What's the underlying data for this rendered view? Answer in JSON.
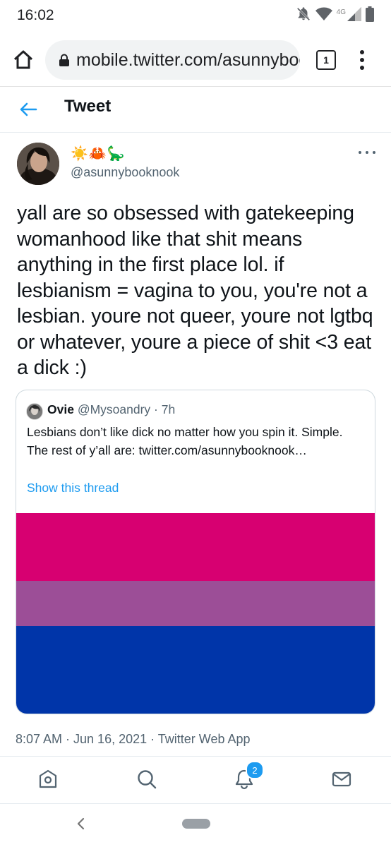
{
  "status_bar": {
    "time": "16:02",
    "network_label": "4G",
    "icons": [
      "notifications-off-icon",
      "wifi-icon",
      "signal-icon",
      "battery-icon"
    ]
  },
  "browser": {
    "url": "mobile.twitter.com/asunnybooknook",
    "tab_count": "1"
  },
  "header": {
    "title": "Tweet"
  },
  "tweet": {
    "display_name": "☀️🦀🦕",
    "handle": "@asunnybooknook",
    "text": "yall are so obsessed with gatekeeping womanhood like that shit means anything in the first place lol. if lesbianism = vagina to you, you're not a lesbian. youre not queer, youre not lgtbq or whatever, youre a piece of shit <3 eat a dick :)",
    "timestamp": "8:07 AM · Jun 16, 2021 · Twitter Web App"
  },
  "quoted_tweet": {
    "name": "Ovie",
    "handle": "@Mysoandry",
    "separator": " · ",
    "time": "7h",
    "text": "Lesbians don’t like dick no matter how you spin it. Simple. The rest of y’all are: twitter.com/asunnybooknook…",
    "show_thread": "Show this thread",
    "image_colors": [
      "#d70071",
      "#9c4e97",
      "#0035a9"
    ]
  },
  "bottom_nav": {
    "items": [
      "home-icon",
      "search-icon",
      "notifications-icon",
      "messages-icon"
    ],
    "notification_count": "2"
  },
  "colors": {
    "accent": "#1d9bf0",
    "text": "#0f1419",
    "secondary_text": "#536471"
  }
}
